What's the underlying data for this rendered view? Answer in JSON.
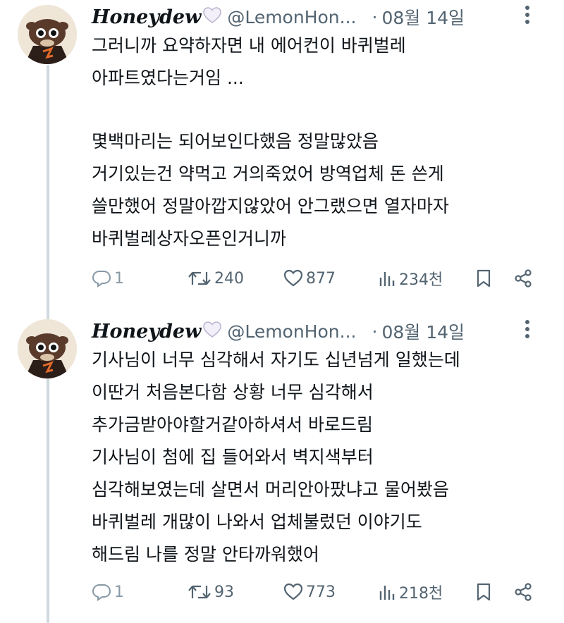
{
  "tweets": [
    {
      "name": "Honeydew",
      "handle": "@LemonHon...",
      "dot": "·",
      "date": "08월 14일",
      "lines": [
        "그러니까 요약하자면 내 에어컨이 바퀴벌레",
        "아파트였다는거임 ...",
        "",
        " 몇백마리는 되어보인다했음 정말많았음",
        "거기있는건 약먹고 거의죽었어 방역업체 돈 쓴게",
        "쓸만했어 정말아깝지않았어 안그랬으면 열자마자",
        "바퀴벌레상자오픈인거니까"
      ],
      "replies": "1",
      "retweets": "240",
      "likes": "877",
      "views": "234천"
    },
    {
      "name": "Honeydew",
      "handle": "@LemonHon...",
      "dot": "·",
      "date": "08월 14일",
      "lines": [
        "기사님이 너무 심각해서 자기도 십년넘게 일했는데",
        "이딴거 처음본다함 상황 너무 심각해서",
        "추가금받아야할거같아하셔서 바로드림",
        "기사님이 첨에 집 들어와서 벽지색부터",
        "심각해보였는데 살면서 머리안아팠냐고 물어봤음",
        "바퀴벌레 개많이 나와서 업체불렀던 이야기도",
        "해드림 나를 정말 안타까워했어"
      ],
      "replies": "1",
      "retweets": "93",
      "likes": "773",
      "views": "218천"
    }
  ],
  "icons": {
    "more": "more-icon",
    "reply": "reply-icon",
    "retweet": "retweet-icon",
    "like": "like-icon",
    "views": "views-icon",
    "bookmark": "bookmark-icon",
    "share": "share-icon",
    "verified_heart": "heart-badge-icon"
  },
  "colors": {
    "secondary_text": "#536471",
    "thread_line": "#cfd9de",
    "main_text": "#0f1419"
  }
}
